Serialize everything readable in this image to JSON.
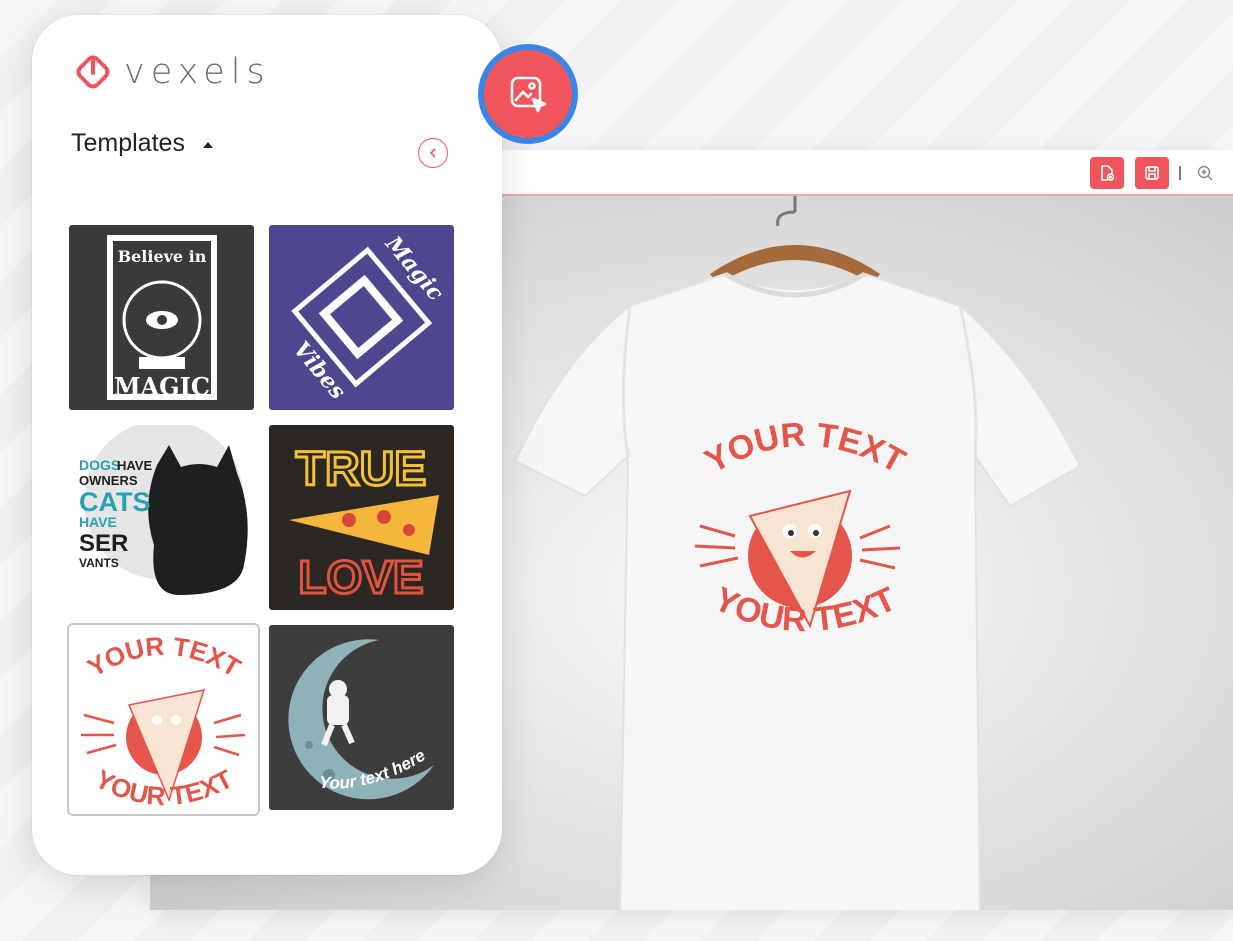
{
  "brand": {
    "name": "vexels",
    "accent": "#f0555c",
    "fab_ring": "#3a86e8"
  },
  "panel": {
    "section_title": "Templates",
    "collapse_icon": "chevron-left-icon",
    "templates": [
      {
        "name": "believe-in-magic",
        "line1": "Believe in",
        "line2": "MAGIC"
      },
      {
        "name": "magic-vibes",
        "line1": "Magic",
        "line2": "Vibes"
      },
      {
        "name": "dogs-cats",
        "lines": [
          "DOGS",
          "HAVE",
          "OWNERS",
          "CATS",
          "HAVE",
          "SER",
          "VANTS"
        ]
      },
      {
        "name": "true-love-pizza",
        "line1": "TRUE",
        "line2": "LOVE"
      },
      {
        "name": "pizza-your-text",
        "line1": "YOUR TEXT",
        "line2": "YOUR TEXT",
        "selected": true
      },
      {
        "name": "astronaut-moon",
        "line1": "Your text here"
      }
    ]
  },
  "toolbar": {
    "buttons": [
      "file-add-icon",
      "save-icon"
    ],
    "zoom_icon": "zoom-in-icon"
  },
  "canvas": {
    "print_top": "YOUR TEXT",
    "print_bottom": "YOUR TEXT"
  }
}
